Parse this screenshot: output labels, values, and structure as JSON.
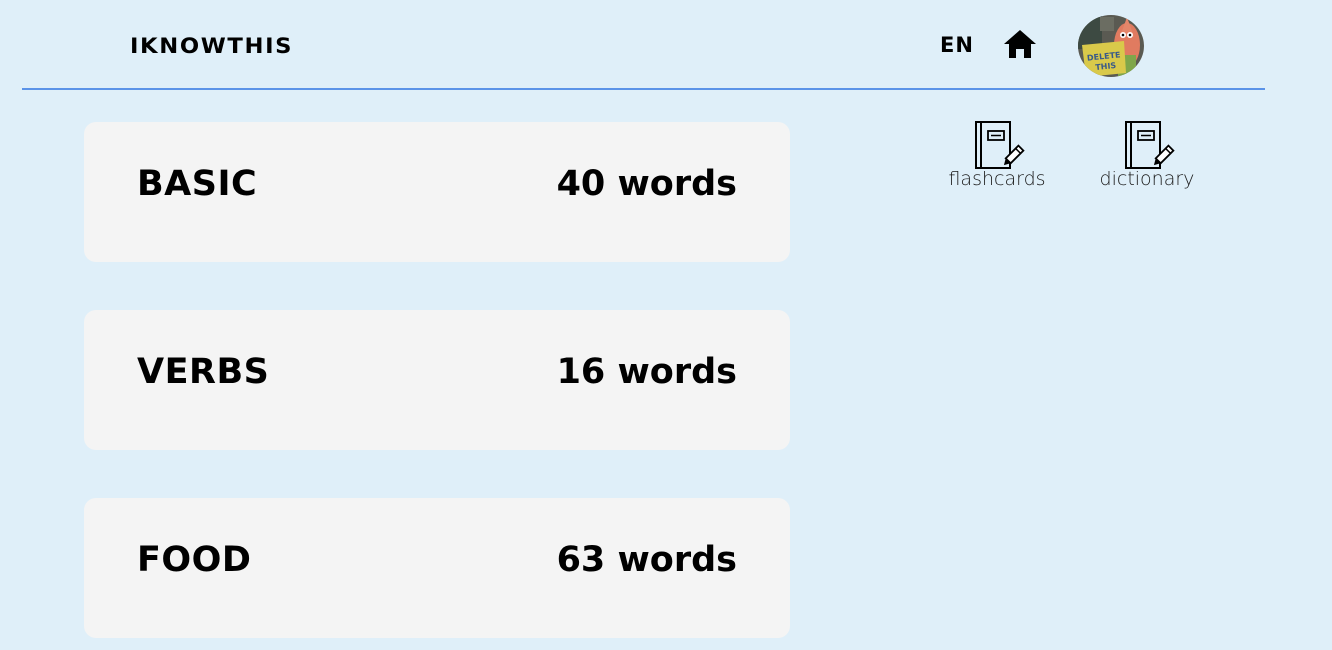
{
  "header": {
    "logo": "IKNOWTHIS",
    "language": "EN",
    "home_icon": "home-icon",
    "avatar_icon": "user-avatar",
    "avatar_sign_text": "DELETE THIS",
    "divider_color": "#5b93e8"
  },
  "categories": [
    {
      "title": "BASIC",
      "count": "40 words"
    },
    {
      "title": "VERBS",
      "count": "16 words"
    },
    {
      "title": "FOOD",
      "count": "63 words"
    }
  ],
  "tools": [
    {
      "label": "flashcards",
      "icon": "notebook-pencil-icon"
    },
    {
      "label": "dictionary",
      "icon": "notebook-pencil-icon"
    }
  ],
  "colors": {
    "background": "#dfeff9",
    "card": "#f4f4f4",
    "accent": "#5b93e8"
  }
}
